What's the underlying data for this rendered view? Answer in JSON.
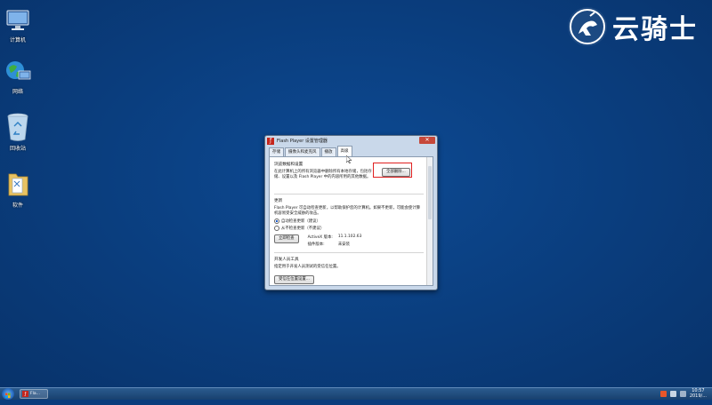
{
  "desktop": {
    "icons": [
      {
        "label": "计算机"
      },
      {
        "label": "网络"
      },
      {
        "label": "回收站"
      },
      {
        "label": "软件"
      }
    ],
    "brand_text": "云骑士"
  },
  "window": {
    "title": "Flash Player 设置管理器",
    "tabs": [
      {
        "label": "存储"
      },
      {
        "label": "摄像头和麦克风"
      },
      {
        "label": "播放"
      },
      {
        "label": "高级"
      }
    ],
    "browse_section": {
      "heading": "浏览数据和设置",
      "text": "在此计算机上的所有浏览器中删除所有本地存储，包括存储、设置以及 Flash Player 中的内容所用的其他数据。",
      "delete_button": "全部删除..."
    },
    "updates_section": {
      "heading": "更新",
      "text": "Flash Player 可自动检查更新，以帮助保护您的计算机。如果不更新，可能会使计算机容易受安全威胁的攻击。",
      "options": [
        {
          "label": "自动检查更新（建议）",
          "checked": true
        },
        {
          "label": "从不检查更新（不建议）",
          "checked": false
        }
      ],
      "check_now_button": "立即检查",
      "activex_label": "ActiveX 版本:",
      "activex_value": "11.1.102.63",
      "plugin_label": "插件版本:",
      "plugin_value": "未安装"
    },
    "dev_section": {
      "heading": "开发人员工具",
      "text": "指定用于开发人员测试的受信任位置。",
      "trusted_button": "受信任位置设置..."
    }
  },
  "taskbar": {
    "task_label": "Fla...",
    "clock_time": "10:57",
    "clock_date": "2019/..."
  }
}
